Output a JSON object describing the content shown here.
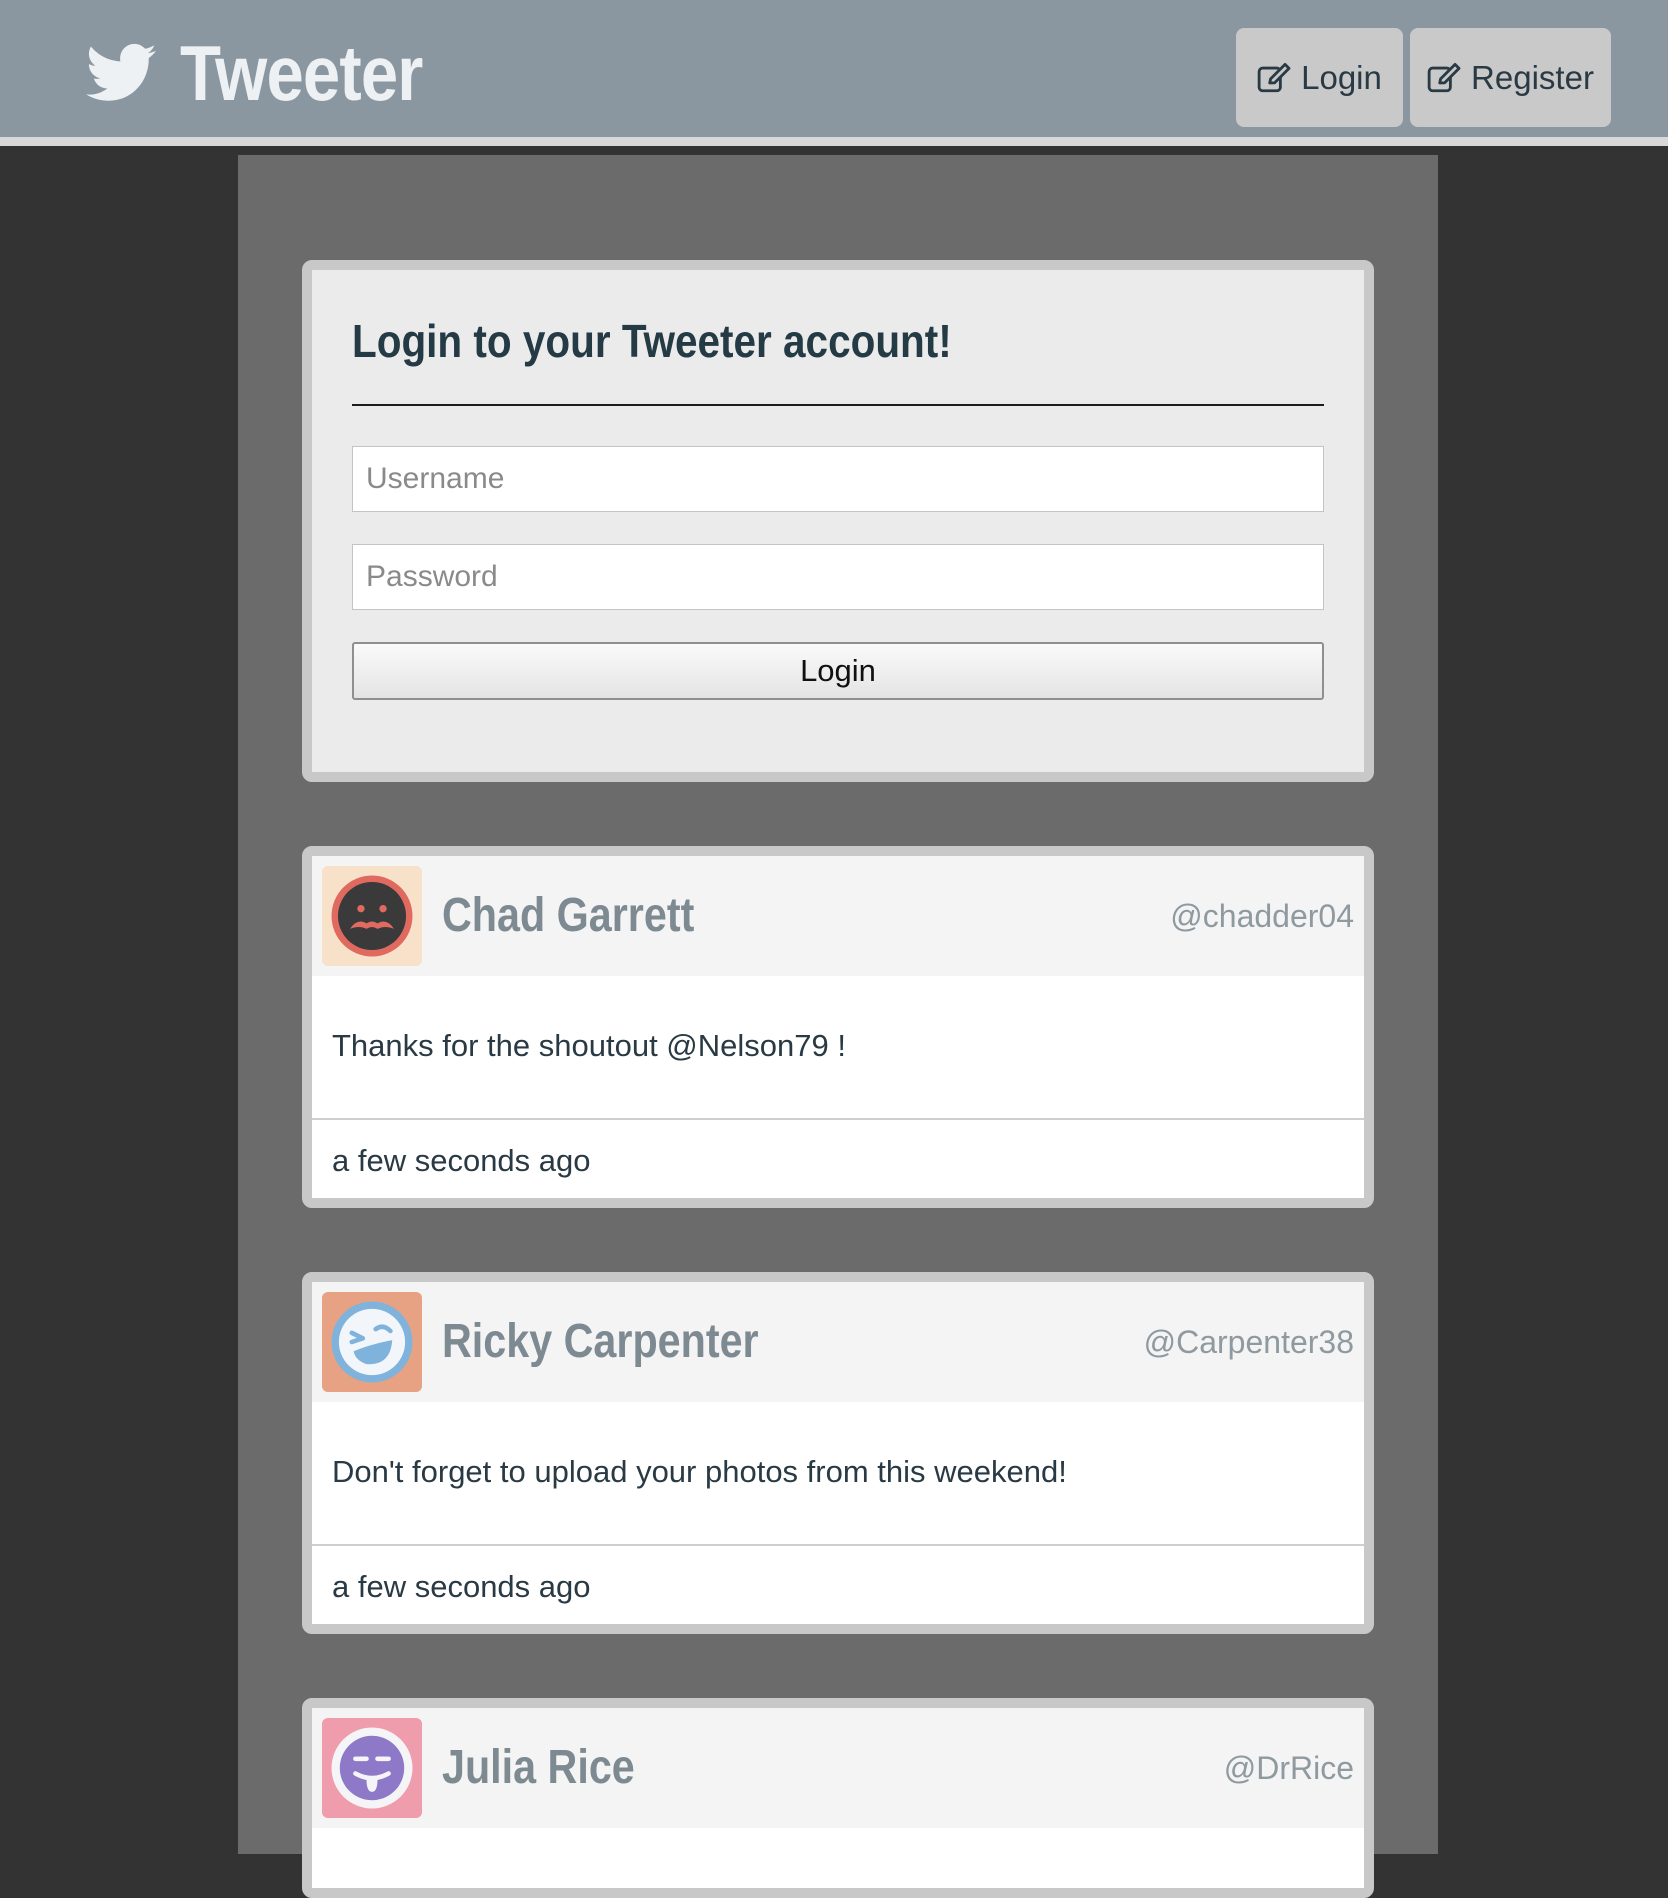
{
  "header": {
    "brand": "Tweeter",
    "login_label": "Login",
    "register_label": "Register"
  },
  "login_form": {
    "title": "Login to your Tweeter account!",
    "username_placeholder": "Username",
    "password_placeholder": "Password",
    "submit_label": "Login"
  },
  "tweets": [
    {
      "name": "Chad Garrett",
      "handle": "@chadder04",
      "text": "Thanks for the shoutout @Nelson79 !",
      "time": "a few seconds ago",
      "avatar_icon": "mustache-face-icon",
      "avatar_bg": "#f7e1c8"
    },
    {
      "name": "Ricky Carpenter",
      "handle": "@Carpenter38",
      "text": "Don't forget to upload your photos from this weekend!",
      "time": "a few seconds ago",
      "avatar_icon": "laughing-face-icon",
      "avatar_bg": "#e6a282"
    },
    {
      "name": "Julia Rice",
      "handle": "@DrRice",
      "avatar_icon": "tongue-out-face-icon",
      "avatar_bg": "#ef9cac"
    }
  ],
  "colors": {
    "header_bg": "#8a97a0",
    "page_bg": "#333333",
    "column_bg": "#6b6b6b",
    "card_border": "#c8c8c8",
    "name_color": "#7d8a92",
    "text_color": "#2a3a44"
  }
}
